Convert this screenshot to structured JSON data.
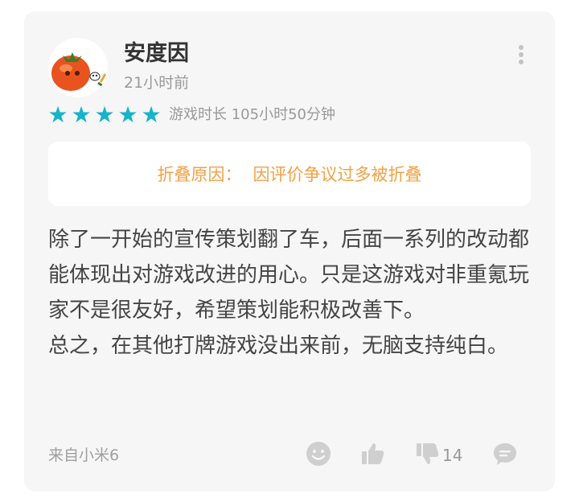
{
  "review": {
    "username": "安度因",
    "time_ago": "21小时前",
    "rating_stars": 5,
    "playtime": "游戏时长 105小时50分钟",
    "fold_notice": {
      "label": "折叠原因：",
      "reason": "因评价争议过多被折叠"
    },
    "body_paragraphs": [
      "除了一开始的宣传策划翻了车，后面一系列的改动都能体现出对游戏改进的用心。只是这游戏对非重氪玩家不是很友好，希望策划能积极改善下。",
      "总之，在其他打牌游戏没出来前，无脑支持纯白。"
    ],
    "device": "来自小米6",
    "dislike_count": "14"
  },
  "icons": {
    "star": "star-icon",
    "more": "more-vertical-icon",
    "emoji": "smiley-icon",
    "like": "thumbs-up-icon",
    "dislike": "thumbs-down-icon",
    "comment": "comment-bubble-icon"
  },
  "colors": {
    "star": "#14b4c9",
    "fold_text": "#f2a145",
    "icon_gray": "#cfcfcf"
  }
}
